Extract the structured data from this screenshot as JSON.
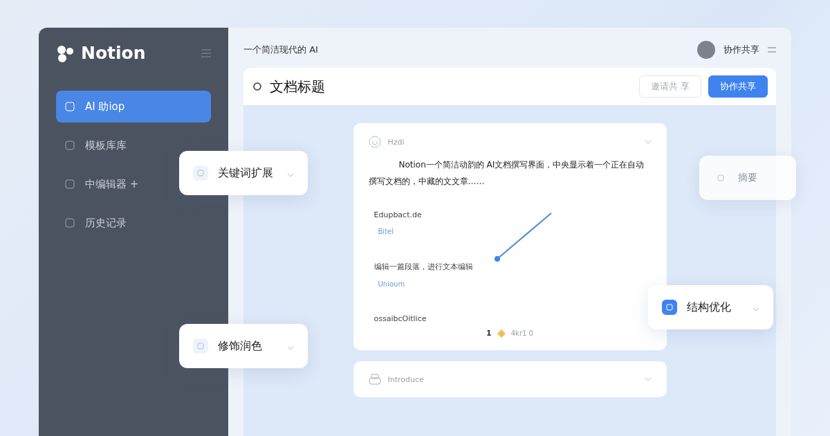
{
  "sidebar": {
    "brand": "Notion",
    "items": [
      {
        "label": "AI 助iop",
        "selected": true
      },
      {
        "label": "模板库库",
        "selected": false
      },
      {
        "label": "中编辑器 +",
        "selected": false
      },
      {
        "label": "历史记录",
        "selected": false
      }
    ]
  },
  "header": {
    "title": "一个简洁现代的 AI",
    "user": "协作共享"
  },
  "document": {
    "title": "文档标题",
    "secondary_button": "邀请共 享",
    "primary_button": "协作共享"
  },
  "card": {
    "label": "Hzdi",
    "paragraph": "Notion一个简洁动韵的 AI文档撰写界面，中央显示着一个正在自动撰写文档的，中藏的文文章……",
    "items": [
      {
        "text": "Edupbact.de",
        "sub": "Bitel"
      },
      {
        "text": "编辑一篇段落，进行文本编辑",
        "sub": "Unioum"
      },
      {
        "text": "ossaibcOitlice"
      }
    ],
    "footer_number": "1",
    "footer_text": "4kr1 0"
  },
  "second_card": {
    "label": "Introduce"
  },
  "floating": [
    {
      "label": "关键词扩展",
      "kind": "plain"
    },
    {
      "label": "修饰润色",
      "kind": "plain"
    },
    {
      "label": "结构优化",
      "kind": "accent"
    },
    {
      "label": "摘要",
      "kind": "faded"
    }
  ]
}
